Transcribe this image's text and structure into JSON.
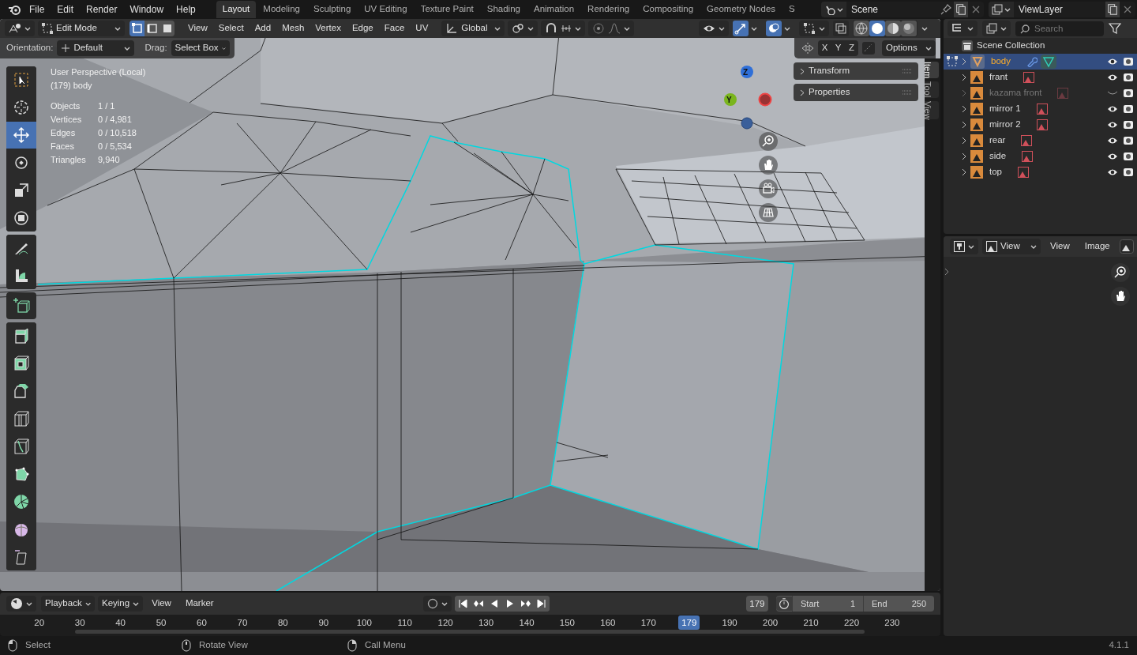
{
  "top_bar": {
    "menus": [
      "File",
      "Edit",
      "Render",
      "Window",
      "Help"
    ],
    "workspaces": [
      {
        "label": "Layout",
        "selected": true
      },
      {
        "label": "Modeling",
        "selected": false
      },
      {
        "label": "Sculpting",
        "selected": false
      },
      {
        "label": "UV Editing",
        "selected": false
      },
      {
        "label": "Texture Paint",
        "selected": false
      },
      {
        "label": "Shading",
        "selected": false
      },
      {
        "label": "Animation",
        "selected": false
      },
      {
        "label": "Rendering",
        "selected": false
      },
      {
        "label": "Compositing",
        "selected": false
      },
      {
        "label": "Geometry Nodes",
        "selected": false
      },
      {
        "label": "S",
        "selected": false
      }
    ],
    "scene": "Scene",
    "view_layer": "ViewLayer"
  },
  "viewport": {
    "mode": "Edit Mode",
    "select_modes": [
      {
        "selected": true
      },
      {
        "selected": false
      },
      {
        "selected": false
      }
    ],
    "menus": [
      "View",
      "Select",
      "Add",
      "Mesh",
      "Vertex",
      "Edge",
      "Face",
      "UV"
    ],
    "orientation": "Global",
    "shading_modes": [
      {
        "selected": false
      },
      {
        "selected": true
      },
      {
        "selected": false
      },
      {
        "selected": false
      }
    ],
    "tool_settings": {
      "orientation_label": "Orientation:",
      "orientation": "Default",
      "drag_label": "Drag:",
      "drag": "Select Box",
      "axes": [
        "X",
        "Y",
        "Z"
      ],
      "options": "Options"
    },
    "view_name": "User Perspective (Local)",
    "object_name": "(179) body",
    "stats": [
      {
        "label": "Objects",
        "value": "1 / 1"
      },
      {
        "label": "Vertices",
        "value": "0 / 4,981"
      },
      {
        "label": "Edges",
        "value": "0 / 10,518"
      },
      {
        "label": "Faces",
        "value": "0 / 5,534"
      },
      {
        "label": "Triangles",
        "value": "9,940"
      }
    ],
    "toolbar": [
      [
        {
          "kind": "select",
          "selected": false
        },
        {
          "kind": "cursor",
          "selected": false
        },
        {
          "kind": "move",
          "selected": true
        },
        {
          "kind": "rotate",
          "selected": false
        },
        {
          "kind": "scale",
          "selected": false
        },
        {
          "kind": "transform",
          "selected": false
        }
      ],
      [
        {
          "kind": "annotate",
          "selected": false
        },
        {
          "kind": "measure",
          "selected": false
        }
      ],
      [
        {
          "kind": "add-cube",
          "selected": false
        }
      ],
      [
        {
          "kind": "extrude",
          "selected": false
        },
        {
          "kind": "inset",
          "selected": false
        },
        {
          "kind": "bevel",
          "selected": false
        },
        {
          "kind": "loop-cut",
          "selected": false
        },
        {
          "kind": "knife",
          "selected": false
        },
        {
          "kind": "poly-build",
          "selected": false
        },
        {
          "kind": "spin",
          "selected": false
        },
        {
          "kind": "smooth",
          "selected": false
        },
        {
          "kind": "shear",
          "selected": false
        }
      ]
    ],
    "gizmo": {
      "z": "Z",
      "y": "Y"
    },
    "panels": [
      "Transform",
      "Properties"
    ],
    "side_tabs": [
      {
        "label": "Item",
        "selected": true
      },
      {
        "label": "Tool",
        "selected": false
      },
      {
        "label": "View",
        "selected": false
      }
    ]
  },
  "outliner": {
    "search_placeholder": "Search",
    "root": "Scene Collection",
    "items": [
      {
        "name": "body",
        "kind": "mesh",
        "selected": true,
        "hidden": false
      },
      {
        "name": "frant",
        "kind": "image",
        "selected": false,
        "hidden": false
      },
      {
        "name": "kazama front",
        "kind": "image",
        "selected": false,
        "hidden": true
      },
      {
        "name": "mirror 1",
        "kind": "image",
        "selected": false,
        "hidden": false
      },
      {
        "name": "mirror 2",
        "kind": "image",
        "selected": false,
        "hidden": false
      },
      {
        "name": "rear",
        "kind": "image",
        "selected": false,
        "hidden": false
      },
      {
        "name": "side",
        "kind": "image",
        "selected": false,
        "hidden": false
      },
      {
        "name": "top",
        "kind": "image",
        "selected": false,
        "hidden": false
      }
    ]
  },
  "image_editor": {
    "view_mode": "View",
    "menus": [
      "View",
      "Image"
    ]
  },
  "timeline": {
    "menus": [
      "Playback",
      "Keying",
      "View",
      "Marker"
    ],
    "current_frame": "179",
    "start_label": "Start",
    "start": "1",
    "end_label": "End",
    "end": "250",
    "ruler_before": [
      "20",
      "30",
      "40",
      "50",
      "60",
      "70",
      "80",
      "90",
      "100",
      "110",
      "120",
      "130",
      "140",
      "150",
      "160",
      "170"
    ],
    "playhead": "179",
    "ruler_after": [
      "190",
      "200",
      "210",
      "220",
      "230"
    ]
  },
  "status_bar": {
    "hints": [
      {
        "kind": "left",
        "label": "Select"
      },
      {
        "kind": "middle",
        "label": "Rotate View"
      },
      {
        "kind": "right",
        "label": "Call Menu"
      }
    ],
    "version": "4.1.1"
  }
}
